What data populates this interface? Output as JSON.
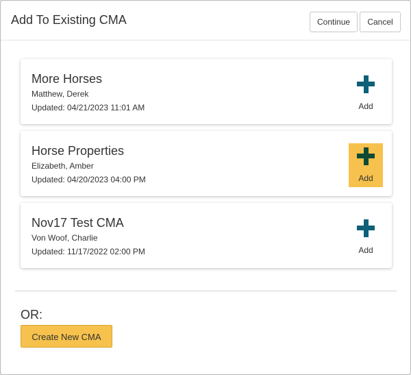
{
  "modal": {
    "title": "Add To Existing CMA",
    "continue_label": "Continue",
    "cancel_label": "Cancel"
  },
  "cmas": [
    {
      "name": "More Horses",
      "owner": "Matthew, Derek",
      "updated": "Updated: 04/21/2023 11:01 AM",
      "add_label": "Add",
      "add_icon": "plus-icon"
    },
    {
      "name": "Horse Properties",
      "owner": "Elizabeth, Amber",
      "updated": "Updated: 04/20/2023 04:00 PM",
      "add_label": "Add",
      "add_icon": "plus-icon",
      "hovered": true
    },
    {
      "name": "Nov17 Test CMA",
      "owner": "Von Woof, Charlie",
      "updated": "Updated: 11/17/2022 02:00 PM",
      "add_label": "Add",
      "add_icon": "plus-icon"
    }
  ],
  "footer": {
    "or_label": "OR:",
    "create_label": "Create New CMA"
  },
  "colors": {
    "accent": "#f6c14c",
    "plus_icon": "#0e5f78",
    "plus_icon_hover": "#0f4a34"
  }
}
